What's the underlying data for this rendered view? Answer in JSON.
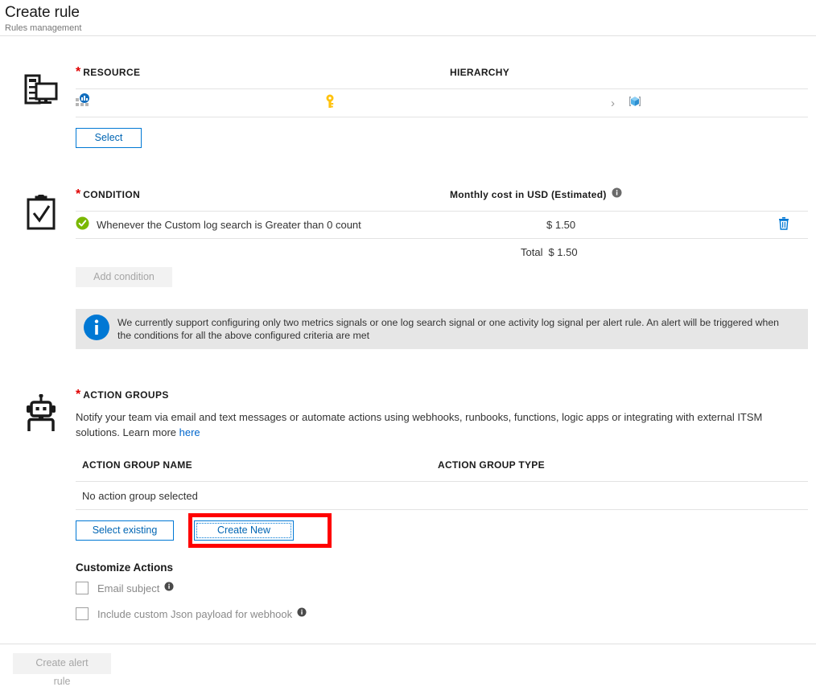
{
  "header": {
    "title": "Create rule",
    "subtitle": "Rules management"
  },
  "resource": {
    "icon": "server-monitor-icon",
    "required_marker": "*",
    "label": "RESOURCE",
    "hierarchy_label": "HIERARCHY",
    "row": {
      "resource_icon": "metrics-chart-icon",
      "resource_name": "",
      "subscription_icon": "key-icon",
      "subscription_name": "",
      "separator": "›",
      "resource_group_icon": "resource-group-cube-icon",
      "resource_group_name": ""
    },
    "select_button": "Select"
  },
  "condition": {
    "icon": "clipboard-check-icon",
    "required_marker": "*",
    "label": "CONDITION",
    "cost_column_header": "Monthly cost in USD (Estimated)",
    "cost_info_icon": "info-icon",
    "rows": [
      {
        "status_icon": "success-check-icon",
        "text": "Whenever the Custom log search is Greater than 0 count",
        "cost": "$ 1.50",
        "delete_icon": "trash-icon"
      }
    ],
    "total_label": "Total",
    "total_value": "$ 1.50",
    "add_condition_button": "Add condition",
    "add_condition_disabled": true,
    "banner": {
      "icon": "info-icon",
      "text": "We currently support configuring only two metrics signals or one log search signal or one activity log signal per alert rule. An alert will be triggered when the conditions for all the above configured criteria are met"
    }
  },
  "action_groups": {
    "icon": "robot-icon",
    "required_marker": "*",
    "label": "ACTION GROUPS",
    "description": "Notify your team via email and text messages or automate actions using webhooks, runbooks, functions, logic apps or integrating with external ITSM solutions.",
    "learn_more_prefix": "Learn more ",
    "learn_more_link": "here",
    "columns": {
      "name": "ACTION GROUP NAME",
      "type": "ACTION GROUP TYPE"
    },
    "empty_text": "No action group selected",
    "select_existing_button": "Select existing",
    "create_new_button": "Create New",
    "customize": {
      "title": "Customize Actions",
      "items": [
        {
          "label": "Email subject",
          "checked": false,
          "info_icon": "info-icon"
        },
        {
          "label": "Include custom Json payload for webhook",
          "checked": false,
          "info_icon": "info-icon"
        }
      ]
    }
  },
  "footer": {
    "create_button": "Create alert rule",
    "create_button_disabled": true
  },
  "annotation": {
    "type": "highlight-rectangle",
    "color": "#ff0000",
    "target": "create-new-button"
  },
  "colors": {
    "accent_blue": "#0078d4",
    "link_blue": "#0066cc",
    "required_red": "#e00000",
    "annotation_red": "#ff0000",
    "success_green": "#7ab800",
    "key_yellow": "#ffc20e",
    "banner_gray": "#e6e6e6"
  }
}
